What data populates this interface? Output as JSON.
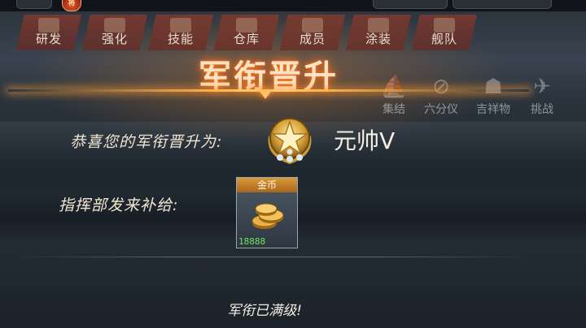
{
  "tabs": [
    {
      "label": "研发",
      "icon": "research-icon"
    },
    {
      "label": "强化",
      "icon": "upgrade-icon"
    },
    {
      "label": "技能",
      "icon": "skill-icon"
    },
    {
      "label": "仓库",
      "icon": "warehouse-icon"
    },
    {
      "label": "成员",
      "icon": "member-icon"
    },
    {
      "label": "涂装",
      "icon": "paint-icon"
    },
    {
      "label": "舰队",
      "icon": "fleet-icon"
    }
  ],
  "side_buttons": [
    {
      "label": "集结",
      "icon": "rally-icon"
    },
    {
      "label": "六分仪",
      "icon": "sextant-icon"
    },
    {
      "label": "吉祥物",
      "icon": "mascot-icon"
    },
    {
      "label": "挑战",
      "icon": "challenge-icon"
    }
  ],
  "top_badge": "将",
  "dialog": {
    "title": "军衔晋升",
    "congrats_label": "恭喜您的军衔晋升为:",
    "rank_name": "元帅V",
    "supply_label": "指挥部发来补给:",
    "reward": {
      "name": "金币",
      "quantity": "18888",
      "icon": "gold-coin-icon"
    },
    "max_note": "军衔已满级!"
  },
  "colors": {
    "title_glow": "#ff7a20",
    "tab_bg": "#8a2a1c",
    "reward_head": "#c9842c",
    "quantity_text": "#6fe35a"
  }
}
